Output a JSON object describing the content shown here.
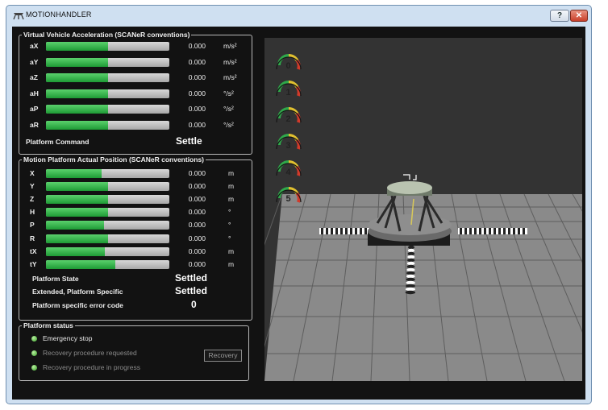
{
  "window": {
    "title": "MOTIONHANDLER",
    "help_label": "?",
    "close_label": "✕"
  },
  "acceleration": {
    "title": "Virtual Vehicle Acceleration (SCANeR conventions)",
    "rows": [
      {
        "label": "aX",
        "value": "0.000",
        "unit": "m/s²",
        "level": 0.5
      },
      {
        "label": "aY",
        "value": "0.000",
        "unit": "m/s²",
        "level": 0.5
      },
      {
        "label": "aZ",
        "value": "0.000",
        "unit": "m/s²",
        "level": 0.5
      },
      {
        "label": "aH",
        "value": "0.000",
        "unit": "°/s²",
        "level": 0.5
      },
      {
        "label": "aP",
        "value": "0.000",
        "unit": "°/s²",
        "level": 0.5
      },
      {
        "label": "aR",
        "value": "0.000",
        "unit": "°/s²",
        "level": 0.5
      }
    ],
    "command_label": "Platform Command",
    "command_value": "Settle"
  },
  "position": {
    "title": "Motion Platform Actual Position (SCANeR conventions)",
    "rows": [
      {
        "label": "X",
        "value": "0.000",
        "unit": "m",
        "level": 0.45
      },
      {
        "label": "Y",
        "value": "0.000",
        "unit": "m",
        "level": 0.5
      },
      {
        "label": "Z",
        "value": "0.000",
        "unit": "m",
        "level": 0.5
      },
      {
        "label": "H",
        "value": "0.000",
        "unit": "°",
        "level": 0.5
      },
      {
        "label": "P",
        "value": "0.000",
        "unit": "°",
        "level": 0.47
      },
      {
        "label": "R",
        "value": "0.000",
        "unit": "°",
        "level": 0.5
      },
      {
        "label": "tX",
        "value": "0.000",
        "unit": "m",
        "level": 0.48
      },
      {
        "label": "tY",
        "value": "0.000",
        "unit": "m",
        "level": 0.56
      }
    ],
    "state_label": "Platform State",
    "state_value": "Settled",
    "extended_label": "Extended, Platform Specific",
    "extended_value": "Settled",
    "error_label": "Platform specific error code",
    "error_value": "0"
  },
  "status": {
    "title": "Platform status",
    "items": [
      {
        "label": "Emergency stop",
        "active": true
      },
      {
        "label": "Recovery procedure requested",
        "active": false
      },
      {
        "label": "Recovery procedure in progress",
        "active": false
      }
    ],
    "recovery_button": "Recovery"
  },
  "gauges": [
    "0",
    "1",
    "2",
    "3",
    "4",
    "5"
  ],
  "colors": {
    "bar_fill": "#2fb045",
    "bar_track": "#c0c0c0",
    "viewport_bg": "#333333",
    "client_bg": "#121212",
    "floor": "#8a8a8a"
  }
}
